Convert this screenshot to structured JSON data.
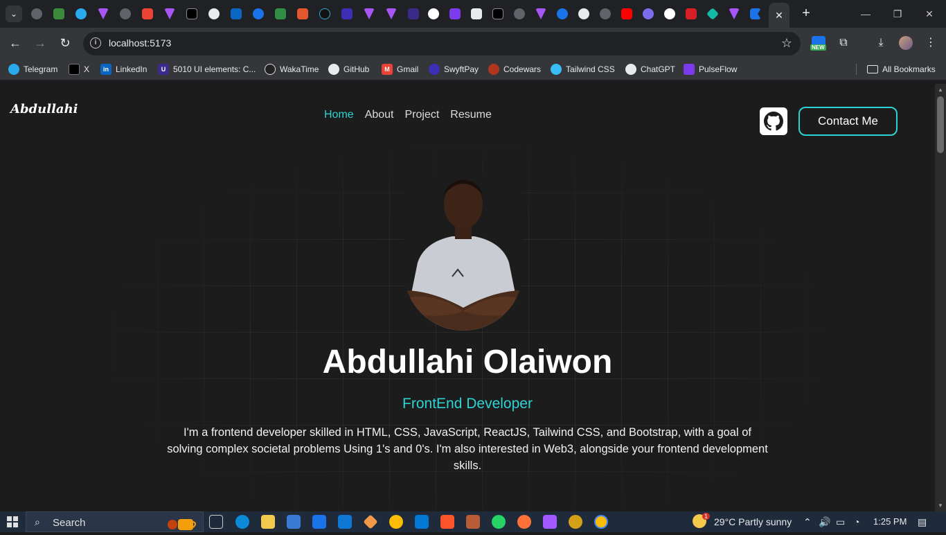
{
  "browser": {
    "new_badge": "NEW",
    "url": "localhost:5173",
    "bookmarks": [
      {
        "label": "Telegram",
        "icon": "telegram-icon",
        "color": "#2aabee"
      },
      {
        "label": "X",
        "icon": "x-icon",
        "color": "#000000"
      },
      {
        "label": "LinkedIn",
        "icon": "linkedin-icon",
        "color": "#0a66c2"
      },
      {
        "label": "5010 UI elements: C...",
        "icon": "uiverse-icon",
        "color": "#3b2a8a"
      },
      {
        "label": "WakaTime",
        "icon": "wakatime-icon",
        "color": "#222222"
      },
      {
        "label": "GitHub",
        "icon": "github-icon",
        "color": "#222222"
      },
      {
        "label": "Gmail",
        "icon": "gmail-icon",
        "color": "#ea4335"
      },
      {
        "label": "SwyftPay",
        "icon": "swyftpay-icon",
        "color": "#3c2fb5"
      },
      {
        "label": "Codewars",
        "icon": "codewars-icon",
        "color": "#b1361e"
      },
      {
        "label": "Tailwind CSS",
        "icon": "tailwind-icon",
        "color": "#38bdf8"
      },
      {
        "label": "ChatGPT",
        "icon": "chatgpt-icon",
        "color": "#444444"
      },
      {
        "label": "PulseFlow",
        "icon": "pulseflow-icon",
        "color": "#7c3aed"
      }
    ],
    "all_bookmarks": "All Bookmarks"
  },
  "site": {
    "logo": "Abdullahi",
    "nav": [
      "Home",
      "About",
      "Project",
      "Resume"
    ],
    "active_nav": "Home",
    "contact_button": "Contact Me",
    "accent_color": "#2ed3d3",
    "name": "Abdullahi Olaiwon",
    "role": "FrontEnd Developer",
    "bio": "I'm a frontend developer skilled in HTML, CSS, JavaScript, ReactJS, Tailwind CSS, and Bootstrap, with a goal of solving complex societal problems Using 1's and 0's. I'm also interested in Web3, alongside your frontend development skills."
  },
  "taskbar": {
    "search_label": "Search",
    "weather_badge": "1",
    "weather": "29°C  Partly sunny",
    "time": "1:25 PM"
  }
}
